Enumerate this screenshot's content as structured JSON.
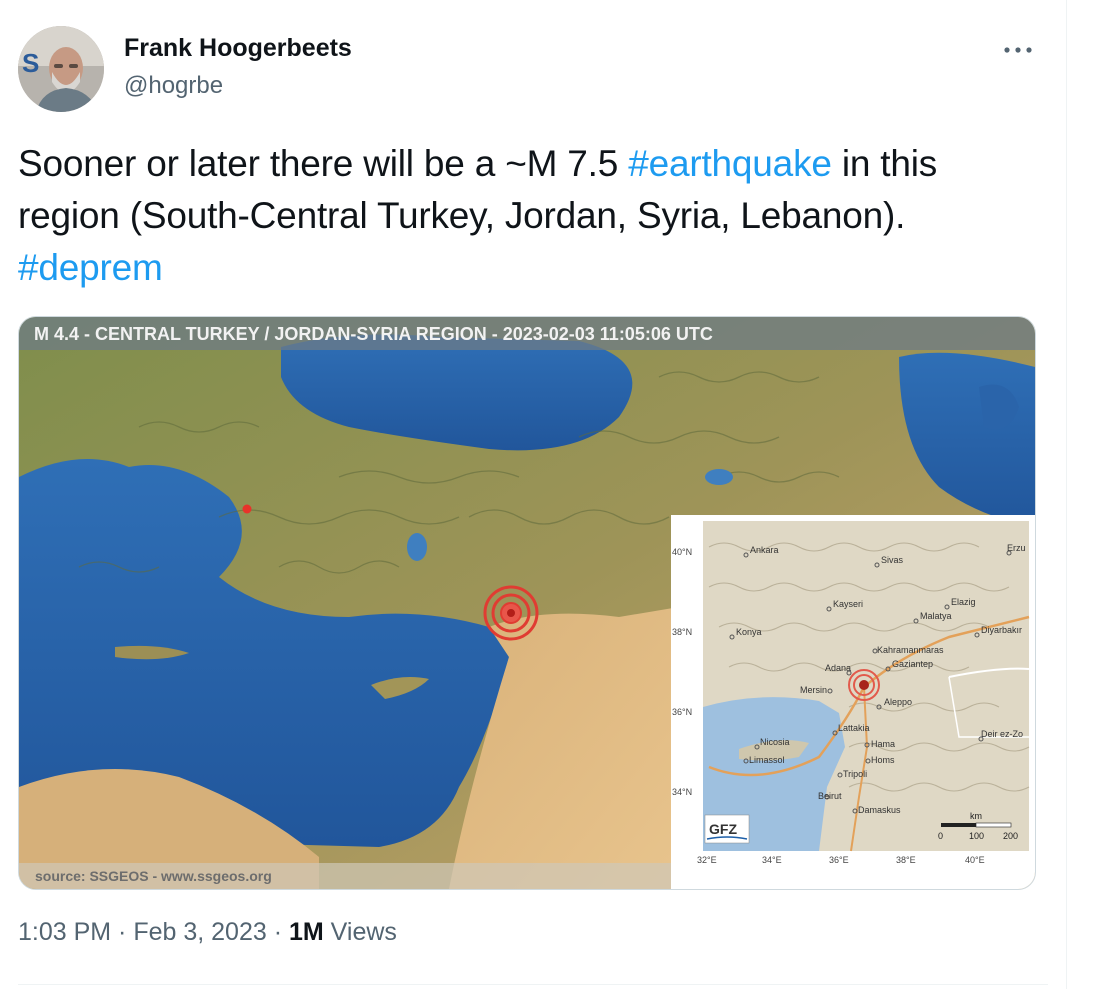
{
  "author": {
    "name": "Frank Hoogerbeets",
    "handle": "@hogrbe",
    "avatar_letters": "S"
  },
  "more_icon": "more-horizontal-icon",
  "tweet": {
    "text_1": "Sooner or later there will be a ~M 7.5 ",
    "hashtag_1": "#earthquake",
    "text_2": " in this region (South-Central Turkey, Jordan, Syria, Lebanon). ",
    "hashtag_2": "#deprem"
  },
  "media": {
    "header": "M 4.4 - CENTRAL TURKEY / JORDAN-SYRIA REGION - 2023-02-03 11:05:06 UTC",
    "source": "source: SSGEOS - www.ssgeos.org",
    "inset": {
      "lat_labels": [
        "40°N",
        "38°N",
        "36°N",
        "34°N"
      ],
      "lon_labels": [
        "32°E",
        "34°E",
        "36°E",
        "38°E",
        "40°E"
      ],
      "cities": [
        "Ankara",
        "Sivas",
        "Erzu",
        "Kayseri",
        "Elazig",
        "Malatya",
        "Konya",
        "Diyarbakır",
        "Kahramanmaras",
        "Gaziantep",
        "Adana",
        "Mersin",
        "Aleppo",
        "Lattakia",
        "Nicosia",
        "Hama",
        "Limassol",
        "Homs",
        "Deir ez-Zo",
        "Tripoli",
        "Beirut",
        "Damaskus"
      ],
      "logo": "GFZ",
      "scale_unit": "km",
      "scale_ticks": [
        "0",
        "100",
        "200"
      ]
    }
  },
  "meta": {
    "time": "1:03 PM",
    "sep_1": " · ",
    "date": "Feb 3, 2023",
    "sep_2": " · ",
    "views_count": "1M",
    "views_label": " Views"
  }
}
